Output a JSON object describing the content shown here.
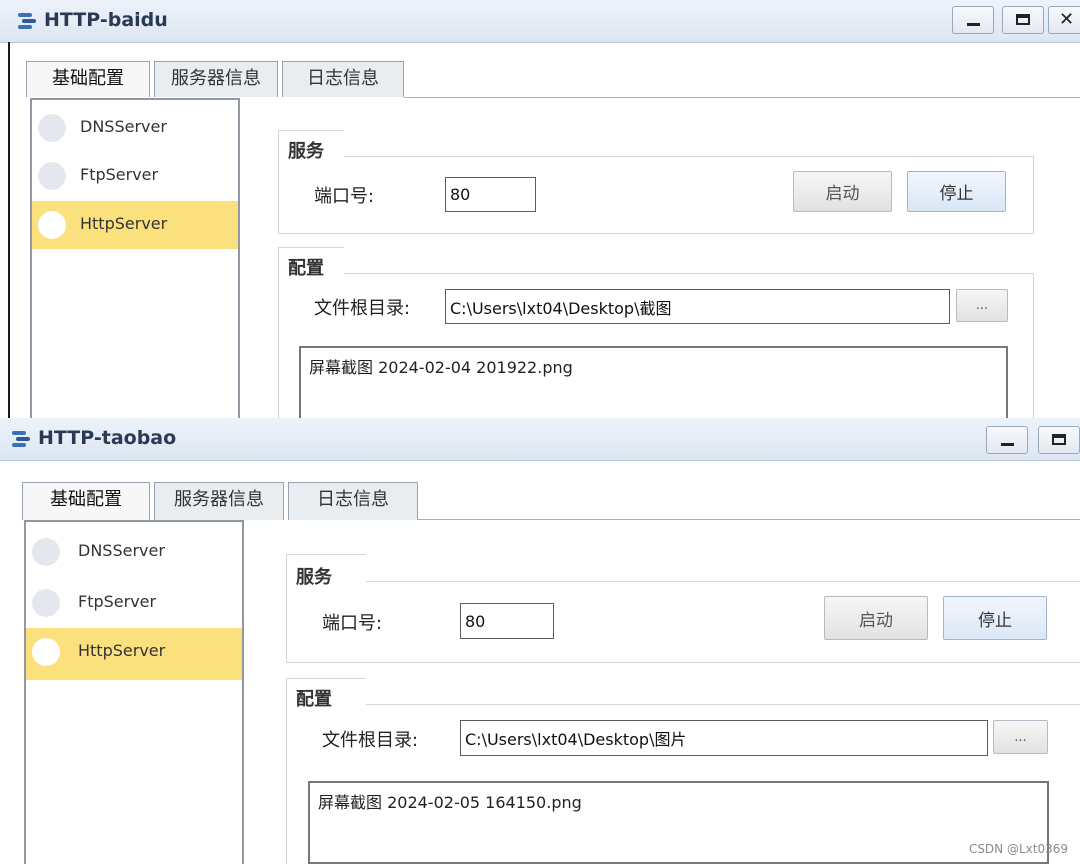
{
  "windows": [
    {
      "title": "HTTP-baidu",
      "tabs": [
        {
          "label": "基础配置",
          "active": true
        },
        {
          "label": "服务器信息",
          "active": false
        },
        {
          "label": "日志信息",
          "active": false
        }
      ],
      "sidebar": [
        {
          "label": "DNSServer",
          "selected": false
        },
        {
          "label": "FtpServer",
          "selected": false
        },
        {
          "label": "HttpServer",
          "selected": true
        }
      ],
      "service": {
        "title": "服务",
        "port_label": "端口号:",
        "port_value": "80",
        "start_label": "启动",
        "stop_label": "停止"
      },
      "config": {
        "title": "配置",
        "root_label": "文件根目录:",
        "root_value": "C:\\Users\\lxt04\\Desktop\\截图",
        "browse_label": "...",
        "files": [
          "屏幕截图 2024-02-04 201922.png"
        ]
      }
    },
    {
      "title": "HTTP-taobao",
      "tabs": [
        {
          "label": "基础配置",
          "active": true
        },
        {
          "label": "服务器信息",
          "active": false
        },
        {
          "label": "日志信息",
          "active": false
        }
      ],
      "sidebar": [
        {
          "label": "DNSServer",
          "selected": false
        },
        {
          "label": "FtpServer",
          "selected": false
        },
        {
          "label": "HttpServer",
          "selected": true
        }
      ],
      "service": {
        "title": "服务",
        "port_label": "端口号:",
        "port_value": "80",
        "start_label": "启动",
        "stop_label": "停止"
      },
      "config": {
        "title": "配置",
        "root_label": "文件根目录:",
        "root_value": "C:\\Users\\lxt04\\Desktop\\图片",
        "browse_label": "...",
        "files": [
          "屏幕截图 2024-02-05 164150.png"
        ]
      }
    }
  ],
  "watermark": "CSDN @Lxt0369",
  "colors": {
    "selected_item": "#fbe17d",
    "titlebar": "#dce6f2",
    "stop_button": "#dbe7f6"
  }
}
